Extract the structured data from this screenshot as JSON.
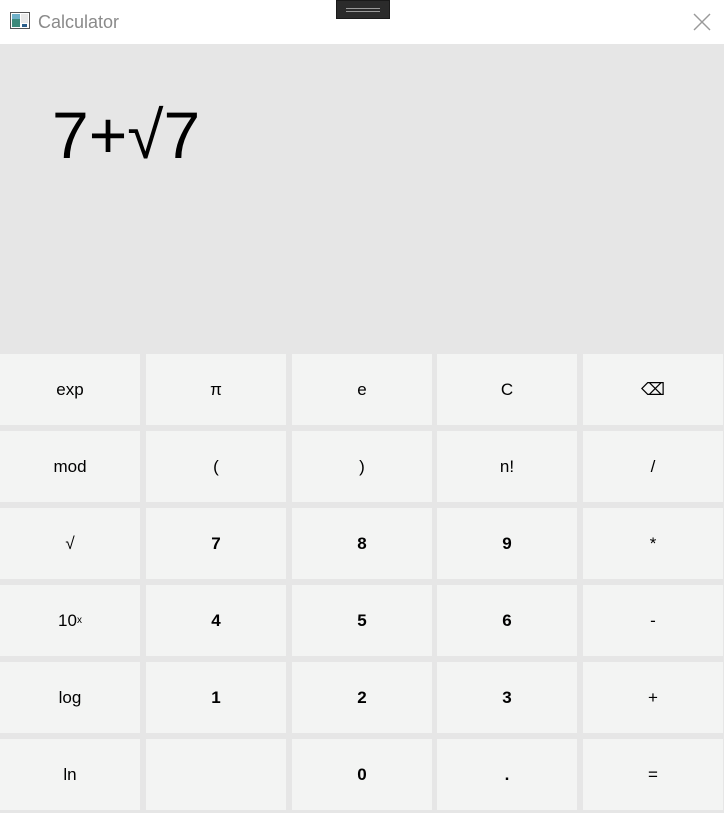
{
  "window": {
    "title": "Calculator",
    "icons": {
      "app": "calculator-app-icon",
      "close": "close-icon",
      "drag": "drag-handle-icon"
    }
  },
  "display": {
    "expression": "7+√7"
  },
  "keypad": {
    "rows": [
      [
        {
          "label": "exp",
          "name": "exp-button"
        },
        {
          "label": "π",
          "name": "pi-button"
        },
        {
          "label": "e",
          "name": "e-button"
        },
        {
          "label": "C",
          "name": "clear-button"
        },
        {
          "label": "⌫",
          "name": "backspace-button",
          "icon": "backspace-icon"
        }
      ],
      [
        {
          "label": "mod",
          "name": "mod-button"
        },
        {
          "label": "(",
          "name": "open-paren-button"
        },
        {
          "label": ")",
          "name": "close-paren-button"
        },
        {
          "label": "n!",
          "name": "factorial-button"
        },
        {
          "label": "/",
          "name": "divide-button"
        }
      ],
      [
        {
          "label": "√",
          "name": "sqrt-button"
        },
        {
          "label": "7",
          "name": "digit-7-button"
        },
        {
          "label": "8",
          "name": "digit-8-button"
        },
        {
          "label": "9",
          "name": "digit-9-button"
        },
        {
          "label": "*",
          "name": "multiply-button"
        }
      ],
      [
        {
          "label": "10",
          "sup": "x",
          "name": "ten-power-button"
        },
        {
          "label": "4",
          "name": "digit-4-button"
        },
        {
          "label": "5",
          "name": "digit-5-button"
        },
        {
          "label": "6",
          "name": "digit-6-button"
        },
        {
          "label": "-",
          "name": "subtract-button"
        }
      ],
      [
        {
          "label": "log",
          "name": "log-button"
        },
        {
          "label": "1",
          "name": "digit-1-button"
        },
        {
          "label": "2",
          "name": "digit-2-button"
        },
        {
          "label": "3",
          "name": "digit-3-button"
        },
        {
          "label": "+",
          "name": "add-button"
        }
      ],
      [
        {
          "label": "ln",
          "name": "ln-button"
        },
        {
          "label": "",
          "name": "blank-button"
        },
        {
          "label": "0",
          "name": "digit-0-button"
        },
        {
          "label": ".",
          "name": "decimal-button"
        },
        {
          "label": "=",
          "name": "equals-button"
        }
      ]
    ]
  },
  "colors": {
    "display_bg": "#e6e6e6",
    "key_bg": "#f3f4f3",
    "titlebar_bg": "#ffffff",
    "title_text": "#8a8a8a"
  }
}
